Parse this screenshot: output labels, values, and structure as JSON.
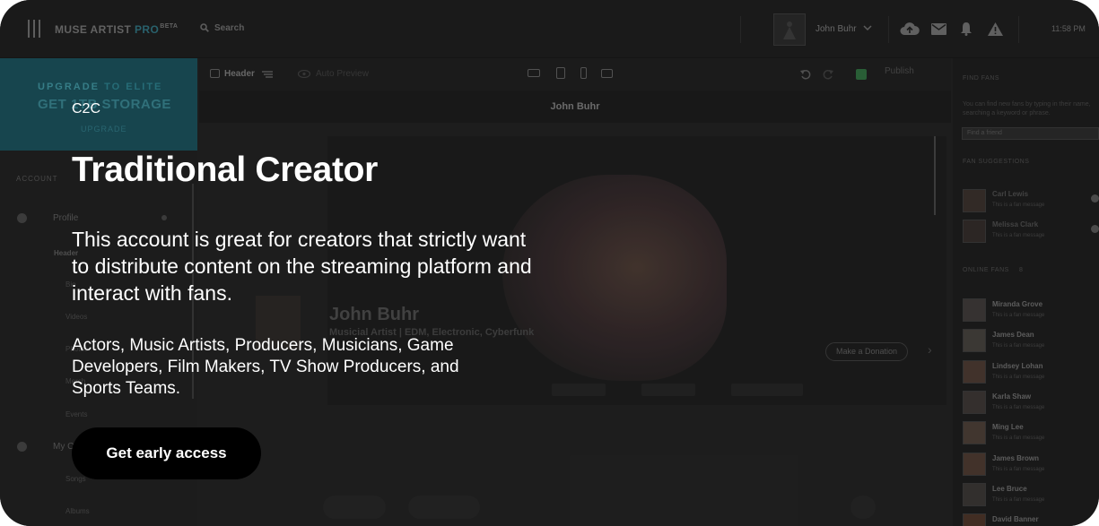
{
  "app": {
    "brand": "MUSE ARTIST",
    "brand_pro": "PRO",
    "brand_beta": "BETA",
    "search_label": "Search",
    "user_name": "John Buhr",
    "clock": "11:58 PM"
  },
  "promo": {
    "line1_a": "UPGRADE",
    "line1_b": "TO ELITE",
    "line2": "GET 1TB STORAGE",
    "cta": "UPGRADE"
  },
  "sidebar": {
    "section_label": "ACCOUNT",
    "profile_label": "Profile",
    "items": [
      "Header",
      "Bio",
      "Videos",
      "Photos",
      "Merch",
      "Events"
    ],
    "my_content_label": "My Content",
    "content_items": [
      "Songs",
      "Albums"
    ]
  },
  "editor": {
    "section_label": "Header",
    "auto_preview_label": "Auto Preview",
    "publish_label": "Publish",
    "preview_title": "John Buhr"
  },
  "hero": {
    "name": "John Buhr",
    "genre": "Musicial Artist | EDM, Electronic, Cyberfunk",
    "donation_button": "Make a Donation"
  },
  "right_sidebar": {
    "find_fans_label": "FIND FANS",
    "find_fans_desc": "You can find new fans by typing in their name, searching a keyword or phrase.",
    "find_placeholder": "Find a friend",
    "suggestions_label": "FAN SUGGESTIONS",
    "suggestions": [
      {
        "name": "Carl Lewis",
        "sub": "This is a fan message"
      },
      {
        "name": "Melissa Clark",
        "sub": "This is a fan message"
      }
    ],
    "online_label": "ONLINE FANS",
    "online_count": "8",
    "online": [
      {
        "name": "Miranda Grove",
        "sub": "This is a fan message"
      },
      {
        "name": "James Dean",
        "sub": "This is a fan message"
      },
      {
        "name": "Lindsey Lohan",
        "sub": "This is a fan message"
      },
      {
        "name": "Karla Shaw",
        "sub": "This is a fan message"
      },
      {
        "name": "Ming Lee",
        "sub": "This is a fan message"
      },
      {
        "name": "James Brown",
        "sub": "This is a fan message"
      },
      {
        "name": "Lee Bruce",
        "sub": "This is a fan message"
      },
      {
        "name": "David Banner",
        "sub": "This is a fan message"
      }
    ]
  },
  "overlay": {
    "eyebrow": "C2C",
    "title": "Traditional Creator",
    "description": "This account is great for creators that strictly want to distribute content on the streaming platform and interact with fans.",
    "audience": "Actors, Music Artists, Producers, Musicians, Game Developers, Film Makers, TV Show Producers, and Sports Teams.",
    "cta_label": "Get early access"
  },
  "colors": {
    "overlay_text": "#ffffff",
    "cta_background": "#000000",
    "promo_teal": "#1b4f59",
    "background": "#222222"
  },
  "icons": [
    "menu-icon",
    "search-icon",
    "chevron-down-icon",
    "cloud-upload-icon",
    "mail-icon",
    "bell-icon",
    "alert-icon",
    "image-icon",
    "lines-icon",
    "eye-icon",
    "laptop-icon",
    "tablet-icon",
    "phone-icon",
    "tv-icon",
    "undo-icon",
    "redo-icon",
    "check-icon",
    "user-icon",
    "gear-icon",
    "arrow-right-icon"
  ]
}
